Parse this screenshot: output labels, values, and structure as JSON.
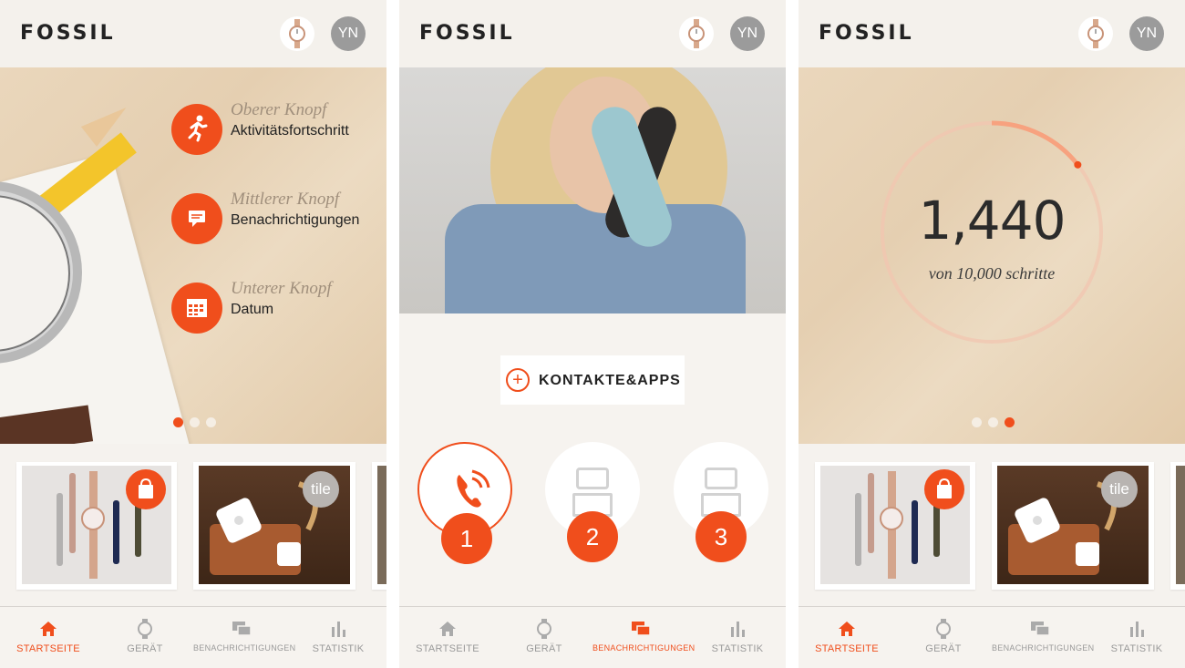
{
  "brand": "FOSSIL",
  "user_initials": "YN",
  "colors": {
    "accent": "#f04e1c",
    "inactive": "#9a9a9a"
  },
  "tabs": [
    {
      "label": "STARTSEITE",
      "icon": "home-icon"
    },
    {
      "label": "GERÄT",
      "icon": "watch-icon"
    },
    {
      "label": "BENACHRICHTIGUNGEN",
      "icon": "chat-icon"
    },
    {
      "label": "STATISTIK",
      "icon": "bar-chart-icon"
    }
  ],
  "screen1": {
    "buttons": [
      {
        "title": "Oberer Knopf",
        "desc": "Aktivitätsfortschritt",
        "icon": "running-icon"
      },
      {
        "title": "Mittlerer Knopf",
        "desc": "Benachrichtigungen",
        "icon": "message-icon"
      },
      {
        "title": "Unterer Knopf",
        "desc": "Datum",
        "icon": "calendar-icon"
      }
    ],
    "active_dot": 1,
    "active_tab": "STARTSEITE"
  },
  "screen2": {
    "add_label": "KONTAKTE&APPS",
    "slots": [
      {
        "number": "1",
        "state": "assigned",
        "icon": "phone-icon"
      },
      {
        "number": "2",
        "state": "empty",
        "icon": "robot-icon"
      },
      {
        "number": "3",
        "state": "empty",
        "icon": "robot-icon"
      }
    ],
    "active_tab": "BENACHRICHTIGUNGEN"
  },
  "screen3": {
    "steps": "1,440",
    "goal_text": "von 10,000 schritte",
    "progress": 0.144,
    "active_dot": 3,
    "active_tab": "STARTSEITE"
  },
  "cards": [
    {
      "type": "straps",
      "badge": "shopping-bag-icon"
    },
    {
      "type": "tile",
      "badge_text": "tile"
    }
  ]
}
